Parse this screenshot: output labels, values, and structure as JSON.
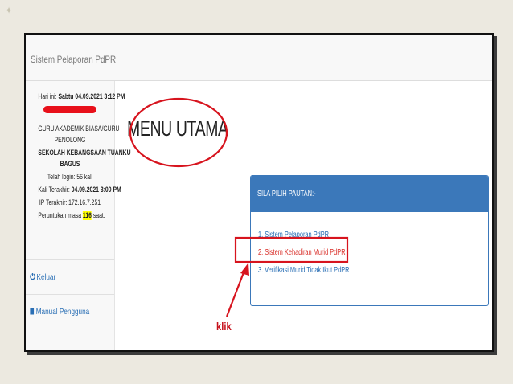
{
  "brand": "Sistem Pelaporan PdPR",
  "user_info": {
    "date_label": "Hari ini:",
    "date_value": "Sabtu 04.09.2021 3:12 PM",
    "role_line1": "GURU AKADEMIK BIASA/GURU",
    "role_line2": "PENOLONG",
    "school_line1": "SEKOLAH KEBANGSAAN TUANKU",
    "school_line2": "BAGUS",
    "login_count": "Telah login: 56 kali",
    "last_label": "Kali Terakhir:",
    "last_value": "04.09.2021 3:00 PM",
    "ip": "IP Terakhir: 172.16.7.251",
    "timeout_prefix": "Peruntukan masa",
    "timeout_value": "116",
    "timeout_suffix": "saat."
  },
  "sidebar": {
    "items": [
      {
        "label": "Keluar",
        "icon": "logout-icon"
      },
      {
        "label": "Manual Pengguna",
        "icon": "book-icon"
      }
    ]
  },
  "main": {
    "title": "MENU UTAMA",
    "panel": {
      "heading": "SILA PILIH PAUTAN:-",
      "links": [
        "1. Sistem Pelaporan PdPR",
        "2. Sistem Kehadiran Murid PdPR",
        "3. Verifikasi Murid Tidak Ikut PdPR"
      ]
    }
  },
  "annotation": {
    "label": "klik",
    "color": "#d7141e"
  },
  "colors": {
    "link": "#2a6fb5",
    "panel_header": "#3b78ba",
    "highlight": "#ffff00"
  }
}
